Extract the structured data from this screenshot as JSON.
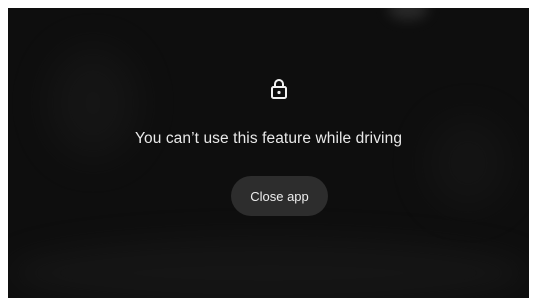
{
  "screen": {
    "message": "You can’t use this feature while driving",
    "close_button_label": "Close app",
    "lock_icon": "lock-icon"
  },
  "colors": {
    "background": "#0e0e0e",
    "button_background": "#2d2d2d",
    "text": "#e9e9e9"
  }
}
